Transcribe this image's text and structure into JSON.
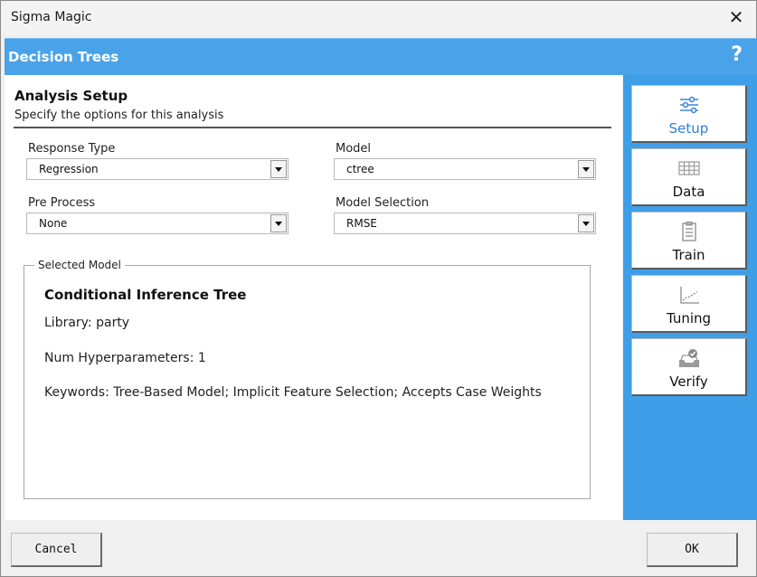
{
  "window": {
    "title": "Sigma Magic",
    "close_glyph": "✕"
  },
  "header": {
    "title": "Decision Trees",
    "help_glyph": "?"
  },
  "section": {
    "title": "Analysis Setup",
    "subtitle": "Specify the options for this analysis"
  },
  "fields": {
    "response_type": {
      "label": "Response Type",
      "value": "Regression"
    },
    "model": {
      "label": "Model",
      "value": "ctree"
    },
    "pre_process": {
      "label": "Pre Process",
      "value": "None"
    },
    "model_selection": {
      "label": "Model Selection",
      "value": "RMSE"
    }
  },
  "selected_model": {
    "legend": "Selected Model",
    "name": "Conditional Inference Tree",
    "library": "Library: party",
    "num_hyperparameters": "Num Hyperparameters: 1",
    "keywords": "Keywords: Tree-Based Model; Implicit Feature Selection; Accepts Case Weights"
  },
  "nav": [
    {
      "label": "Setup",
      "icon": "sliders-icon",
      "active": true
    },
    {
      "label": "Data",
      "icon": "grid-icon",
      "active": false
    },
    {
      "label": "Train",
      "icon": "clipboard-icon",
      "active": false
    },
    {
      "label": "Tuning",
      "icon": "chart-line-icon",
      "active": false
    },
    {
      "label": "Verify",
      "icon": "inbox-check-icon",
      "active": false
    }
  ],
  "footer": {
    "cancel_label": "Cancel",
    "ok_label": "OK"
  },
  "colors": {
    "header_blue": "#4aa3e8",
    "panel_blue": "#3e9ee8",
    "active_label": "#2f7fd8"
  }
}
